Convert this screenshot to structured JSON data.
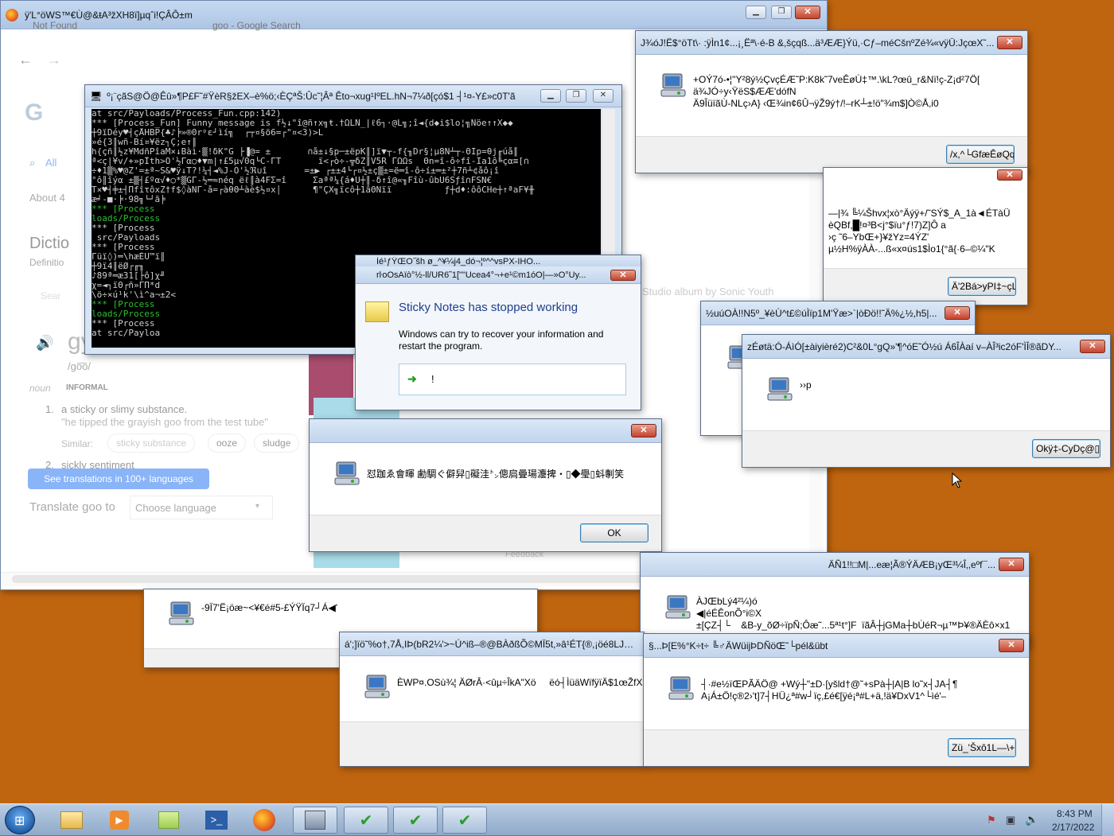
{
  "browser": {
    "window_title": "ÿ'L°öWS™€Ù@&ŧA³žXH8ï]µqˆi!ÇÂÔ±m",
    "tab1": "Not Found",
    "tab2": "goo - Google Search",
    "all_tab": "All",
    "about": "About 4",
    "dict_heading": "Dictio",
    "definitions": "Definitio",
    "search_placeholder": "Sear",
    "word": "gy",
    "pron": "/go͞o/",
    "pos": "noun",
    "register": "INFORMAL",
    "def1": "a sticky or slimy substance.",
    "example1": "\"he tipped the grayish goo from the test tube\"",
    "similar_label": "Similar:",
    "similar1": "sticky substance",
    "similar2": "ooze",
    "similar3": "sludge",
    "def2": "sickly sentiment",
    "translations_button": "See translations in 100+ languages",
    "translate_label": "Translate goo to",
    "choose_language": "Choose language",
    "album_text": "Studio album by Sonic Youth",
    "feedback": "Feedback"
  },
  "console": {
    "title": "º¡¨çãS@Ö@Êû»¶P£F˜#ŸèR§žEX–è%ö;‹ÈÇªŠ:Ûc˜¦Âª Êto¬xug¹IºEL.hN¬7¼ð[çó$1 ┤¹¤-Y£»c0T'ã",
    "lines": [
      {
        "t": "at src/Payloads/Process_Fun.cpp:142)",
        "g": false
      },
      {
        "t": "*** [Process_Fun] Funny message is f½↓\"î@ñ↑x╗ŧ.†ΩLÑ_|ℓ6┐·@L╗;î◄{d◆i$lo¦╗Ñöe↑↑X◆◆",
        "g": false
      },
      {
        "t": "┼9ïDéy♥┤çÅHBP{♣♪╞»®0rᵖε┘ìí╗  ┌┬¤§ö6=┌\"¤<3)>L",
        "g": false
      },
      {
        "t": "»é{3║wñ-Bí¤¥ëz┐Ç;e↑║",
        "g": false
      },
      {
        "t": "h{çñ║½z¥MdñPîaM×↓Bàì·▒!δK\"G ├▐@= ±       ∩å±↓§p─±ëpK║]ï▼┬-f{╖Dr§¦µ8Ñ┴┬-ΘIp=θj╓úå║",
        "g": false
      },
      {
        "t": "ª<ç|¥v/+»pÏth>O'½Γα○♦▼m|↑£5µ√0q└C-ΓΤ       ï<┌ò÷-╦δZ║V5R ΓΩΩs  Θn=î-ô÷fî-Ia1ô╚çα≡[∩",
        "g": false
      },
      {
        "t": "÷♦1▒%♥@Z'=±ª~S&♥ÿ↓T?!¼┤◄%J-Ó'½ℜ∪î       =±▶ ┌±±4└┌¤½±ç▒±=ë═î-ô÷í±═±²┼7ñ┴¢åô¡î",
        "g": false
      },
      {
        "t": "°ô║îýα ±▒┤£ºα√♦○*▒GΓ-½═≈néq ëℓ║à4FΣ=î     Σaªª¼{á♦Ü┼║-δ↑î@«╖Fîù-ûbU6Sƒî∩FSN€",
        "g": false
      },
      {
        "t": "T×♥┤╪±┤ΠfîτôxZ†f$◊àÑΓ-å=┌àθΘ┴àè$½¤x│      ¶\"ÇX╗ïcô┼1âΘÑïï          ƒ┼d♦:ôôCHe┼↑ªaF¥╫",
        "g": false
      },
      {
        "t": "æ╛-■·╞·98╗└┘ã╞",
        "g": false
      },
      {
        "t": "*** [Process",
        "g": true
      },
      {
        "t": "loads/Process",
        "g": true
      },
      {
        "t": "*** [Process",
        "g": false
      },
      {
        "t": " src/Payloads",
        "g": false
      },
      {
        "t": "*** [Process",
        "g": false
      },
      {
        "t": "Γüï◊)═\\hæÉU™ï║",
        "g": false
      },
      {
        "t": "┼9ï4║ëØ┌╓╖",
        "g": false
      },
      {
        "t": "♪89ª═æ31[├ô]χ╜",
        "g": false
      },
      {
        "t": "χ=◄┐ïΘ┌ñ»ΓΠ*d",
        "g": false
      },
      {
        "t": "\\ö÷×ú¹k'\\ì^a¬±2<",
        "g": false
      },
      {
        "t": "*** [Process",
        "g": true
      },
      {
        "t": "loads/Process",
        "g": true
      },
      {
        "t": "*** [Process",
        "g": false
      },
      {
        "t": "at src/Payloa",
        "g": false
      }
    ]
  },
  "sticky_notes": {
    "behind_title1": "Ìé¹ƒŸŒO˝šh ø_^¥¼j4_dó¬¦º^^vsPX-IHO...",
    "behind_title2": "rŀoOsAïò°½-ll/UR6˜1[\"\"Ucea4°¬+e¹©m1óO|—»O°Uy...",
    "heading": "Sticky Notes has stopped working",
    "body_line1": "Windows can try to recover your information and",
    "body_line2": "restart the program.",
    "action_text": "!"
  },
  "dialogs": {
    "d1": {
      "title": "J¾óJ!Ë$°öTt\\· :ÿÌn1¢...¡¸Ëª\\·é-B &,šçqß...ä³ÆÆ}Ýü,·Cƒ–méCšnºZé¾«vÿÜ:JçœX˜...",
      "line1": "+OÝ7ó-•¦''Y²8ý½ÇvçÉÆ˜P:K8k˜7veÊøÙ‡™.\\kL?œû_r&Nï!ç-Z¡d²7Ö[",
      "line2": "ä¾JÓ÷y‹ŸëS$ÆÆ'dófN",
      "line3": "Ä9ÎüïãÙ-NLç›A} ‹Œ¾in¢6Û¬ÿŽ9ý†/!–rK┴±!ö\"¾m$]Ò©Å,i0",
      "button": "/x,^└GfæÊøQq\\"
    },
    "d2": {
      "line1": "—|¾ ╚¼Šhvx¦xò°Äýÿ+/˜SÝ$_A_1à◄ÉTàÜ",
      "line2": "èQBf,█!¤³B<j°$ïu°ƒ!7)Z]Ô a",
      "line3": "›ç ˜6–YbŒ+}¥žYz=4ÝZ'",
      "line4": "µ½H%ÿÀÀ-...ß«x¤ús1$Ìo1{°ã{·6–©¼\"K",
      "button": "Ä'2Bá>yPI‡~çL"
    },
    "d3": {
      "title": "½uúOÀ!!N5º_¥èÙ^t£©úÌïp1M'Ÿæ>`|òÐö!!˜Ä%¿½,h5|...",
      "body": "",
      "button": ""
    },
    "d4": {
      "title": "zÉøtä:Ó-ÁìÓ[±àiyièré2)C²&0L°gQ»'¶^óE˜Ó½ú   Á6ÎÀaí  v–ÀÎ³ic2óF'ÌÎ®ãDY...",
      "body": "››p",
      "button": "Okÿ‡-CyDç@▯◀"
    },
    "d5": {
      "title": "",
      "body": "怼跏ゑ會暉 勴騆ぐ僻舁▯礙洼㌧傯扃曡瑒灋捭・▯◆璺▯蚪剸笑",
      "button": "OK"
    },
    "d6": {
      "body": "-9Ï7'Ë¡öæ~<¥€é#5-£ÝŸÏq7┘Á◀'"
    },
    "d7": {
      "title": "ÄÑ1!!□M|...eæ¦Ã®ÝÄÆB¡yŒ³¼Î‚,eºf¯...",
      "line1": "ÀJŒbLý4²¼)ó",
      "line2": "◀|éÉÊonÕ°i©X",
      "line3": "±[ÇZ┤└    &B-y_õØ÷ïpÑ;Ôæ˜...5ª¹t°]F  ïãÂ┼jGMa┼bÙéR¬µ™Þ¥®ÄÈô×x1"
    },
    "d8": {
      "title": "á';]ïö˜%o†,7Å,IÞ(bR2¼'>~Ú^iß–®@BÀðßÕ©MÏ5t,»â¹ÉT{®,¡öé8LJ¿³/...",
      "body": "ÈWP¤.OSù¾¦ ÄØrÂ·<ûµ÷ÎkA\"Xö     ëó┤ÌüäWïfÿïÄ$1œŽfX°|"
    },
    "d9": {
      "title": "§...Þ[E%°K÷t÷ ╚♂ÄWüijÞDÑöŒ˜└pél&übt",
      "line1": "┤·#e½ïŒPÃÄÖ@ +Wý┼\"±D·[yšld†@˜+sPà┼|A|B lo˜x┤JA┤¶",
      "line2": "A¡Á±Ö!ç®2›'t]7┤HÜ¿ª#w┘ïç,£é€[ÿé¡ª#L+ä,!ä¥DxV1^└ìé'–",
      "button": "Zü_'Šxô1L—\\+b"
    }
  },
  "taskbar": {
    "time": "8:43 PM",
    "date": "2/17/2022"
  },
  "colors": {
    "desktop": "#c0650f",
    "redrect": "#c1573b",
    "magenta": "#a94c6e",
    "cyan": "#a9dbe8"
  }
}
